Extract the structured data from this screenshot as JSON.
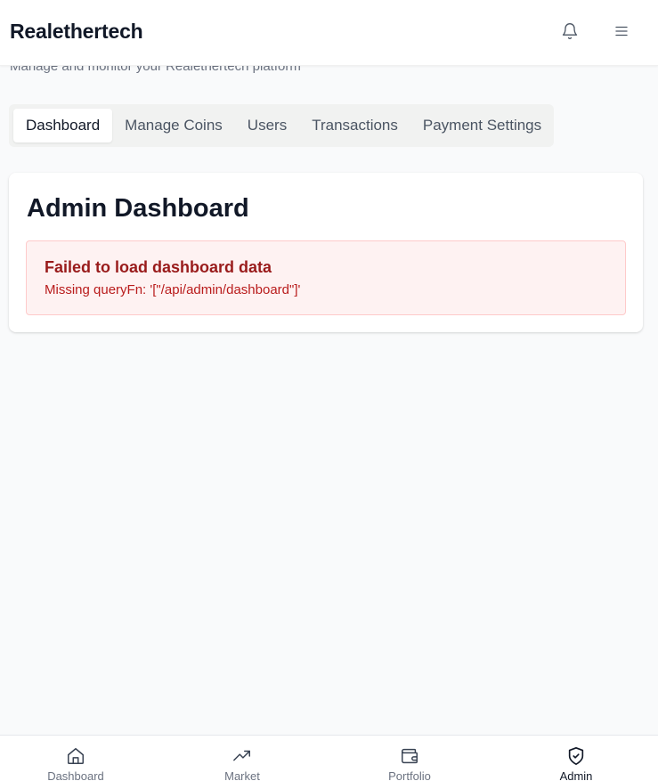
{
  "header": {
    "brand": "Realethertech",
    "subtitle": "Manage and monitor your Realethertech platform",
    "bell_icon": "bell-icon",
    "menu_icon": "menu-icon"
  },
  "tabs": [
    {
      "label": "Dashboard",
      "active": true
    },
    {
      "label": "Manage Coins",
      "active": false
    },
    {
      "label": "Users",
      "active": false
    },
    {
      "label": "Transactions",
      "active": false
    },
    {
      "label": "Payment Settings",
      "active": false
    }
  ],
  "card": {
    "title": "Admin Dashboard",
    "error": {
      "title": "Failed to load dashboard data",
      "message": "Missing queryFn: '[\"/api/admin/dashboard\"]'"
    }
  },
  "bottom_nav": [
    {
      "label": "Dashboard",
      "icon": "home-icon",
      "active": false
    },
    {
      "label": "Market",
      "icon": "trending-up-icon",
      "active": false
    },
    {
      "label": "Portfolio",
      "icon": "wallet-icon",
      "active": false
    },
    {
      "label": "Admin",
      "icon": "shield-check-icon",
      "active": true
    }
  ],
  "colors": {
    "error_bg": "#fef2f2",
    "error_border": "#fecaca",
    "error_title": "#991b1b",
    "error_text": "#b91c1c"
  }
}
